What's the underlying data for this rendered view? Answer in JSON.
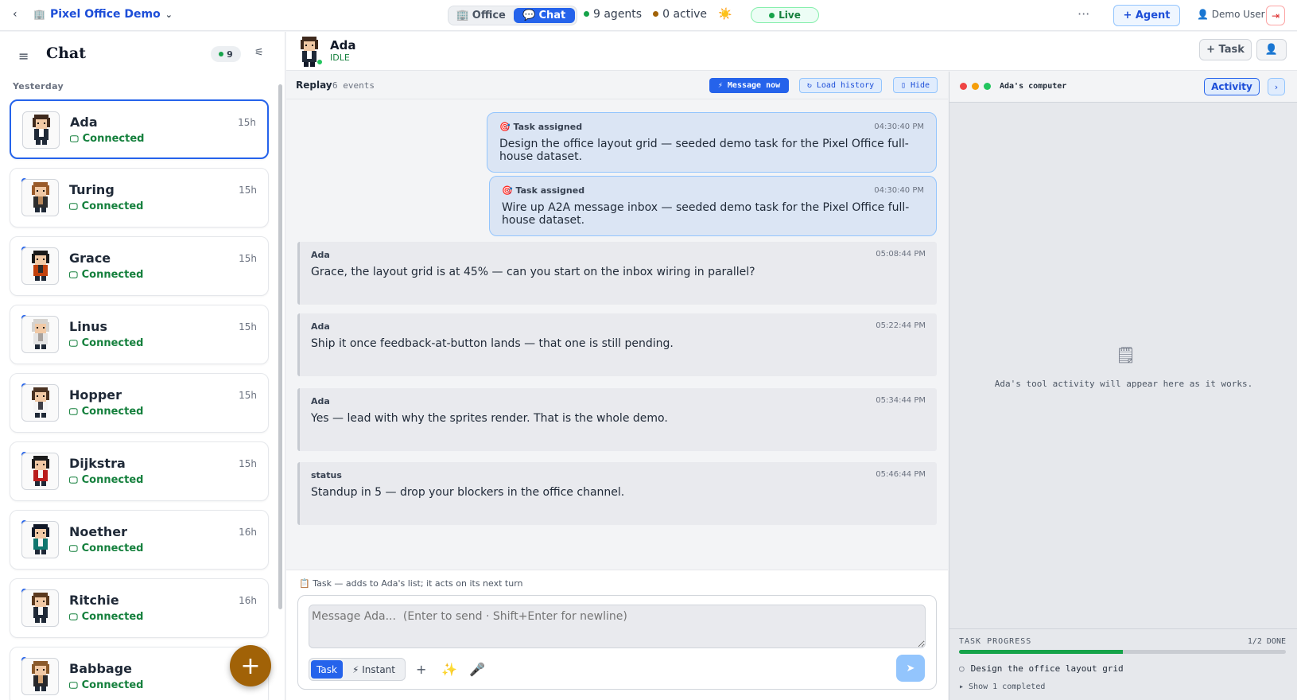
{
  "topbar": {
    "back_icon": "‹",
    "workspace_icon": "🏢",
    "workspace_name": "Pixel Office Demo",
    "workspace_chevron": "⌄",
    "view_tabs": [
      {
        "icon": "🏢",
        "label": "Office",
        "active": false
      },
      {
        "icon": "💬",
        "label": "Chat",
        "active": true
      }
    ],
    "agents_count": "9 agents",
    "active_count": "0 active",
    "weather_icon": "☀️",
    "live_label": "Live",
    "more_icon": "···",
    "add_agent_label": "+ Agent",
    "user_label": "👤 Demo User",
    "logout_icon": "⇥"
  },
  "sidebar": {
    "menu_icon": "≡",
    "title": "Chat",
    "count_badge": "9",
    "filter_icon": "⚟",
    "group_label": "Yesterday",
    "agents": [
      {
        "name": "Ada",
        "status": "Connected",
        "time": "15h",
        "selected": true,
        "unread": false,
        "hair": "#3f2a1d",
        "coat": "#1f2937",
        "accent": "#ffffff"
      },
      {
        "name": "Turing",
        "status": "Connected",
        "time": "15h",
        "selected": false,
        "unread": true,
        "hair": "#9a5b2a",
        "coat": "#2d2d2d",
        "accent": "#b7875a"
      },
      {
        "name": "Grace",
        "status": "Connected",
        "time": "15h",
        "selected": false,
        "unread": true,
        "hair": "#1a1a1a",
        "coat": "#c2410c",
        "accent": "#2a2a2a"
      },
      {
        "name": "Linus",
        "status": "Connected",
        "time": "15h",
        "selected": false,
        "unread": true,
        "hair": "#d6d3cf",
        "coat": "#e5e5e5",
        "accent": "#a8a29e"
      },
      {
        "name": "Hopper",
        "status": "Connected",
        "time": "15h",
        "selected": false,
        "unread": true,
        "hair": "#4a3222",
        "coat": "#f5f5f5",
        "accent": "#3f3f46"
      },
      {
        "name": "Dijkstra",
        "status": "Connected",
        "time": "15h",
        "selected": false,
        "unread": true,
        "hair": "#1c1c1c",
        "coat": "#b91c1c",
        "accent": "#f5f5f5"
      },
      {
        "name": "Noether",
        "status": "Connected",
        "time": "16h",
        "selected": false,
        "unread": true,
        "hair": "#111827",
        "coat": "#0f766e",
        "accent": "#f5f5f5"
      },
      {
        "name": "Ritchie",
        "status": "Connected",
        "time": "16h",
        "selected": false,
        "unread": true,
        "hair": "#5b3a1f",
        "coat": "#1f2937",
        "accent": "#f5f5f5"
      },
      {
        "name": "Babbage",
        "status": "Connected",
        "time": "",
        "selected": false,
        "unread": true,
        "hair": "#8b5a2b",
        "coat": "#27272a",
        "accent": "#d4a373"
      }
    ],
    "status_icon": "🖵",
    "fab_icon": "+"
  },
  "chat_header": {
    "name": "Ada",
    "state": "IDLE",
    "task_button": "+ Task",
    "profile_icon": "👤"
  },
  "replay": {
    "label": "Replay",
    "events": "6 events",
    "message_now": "⚡ Message now",
    "load_history": "↻ Load history",
    "hide": "▯ Hide"
  },
  "messages": {
    "tasks": [
      {
        "icon": "🎯",
        "label": "Task assigned",
        "time": "04:30:40 PM",
        "text": "Design the office layout grid — seeded demo task for the Pixel Office full-house dataset."
      },
      {
        "icon": "🎯",
        "label": "Task assigned",
        "time": "04:30:40 PM",
        "text": "Wire up A2A message inbox — seeded demo task for the Pixel Office full-house dataset."
      }
    ],
    "chat": [
      {
        "who": "Ada",
        "time": "05:08:44 PM",
        "text": "Grace, the layout grid is at 45% — can you start on the inbox wiring in parallel?"
      },
      {
        "who": "Ada",
        "time": "05:22:44 PM",
        "text": "Ship it once feedback-at-button lands — that one is still pending."
      },
      {
        "who": "Ada",
        "time": "05:34:44 PM",
        "text": "Yes — lead with why the sprites render. That is the whole demo."
      },
      {
        "who": "status",
        "time": "05:46:44 PM",
        "text": "Standup in 5 — drop your blockers in the office channel."
      }
    ]
  },
  "composer": {
    "hint": "📋 Task — adds to Ada's list; it acts on its next turn",
    "placeholder": "Message Ada...  (Enter to send · Shift+Enter for newline)",
    "mode_task": "Task",
    "mode_instant": "⚡ Instant",
    "attach_icon": "+",
    "sparkle_icon": "✨",
    "mic_icon": "🎤",
    "send_icon": "➤"
  },
  "computer": {
    "title": "Ada's computer",
    "activity_label": "Activity",
    "collapse_icon": "›",
    "empty_icon": "🗒",
    "empty_text": "Ada's tool activity will appear here as it works.",
    "progress_label": "TASK PROGRESS",
    "progress_count": "1/2 DONE",
    "progress_fraction": 0.5,
    "item_icon": "○",
    "current_item": "Design the office layout grid",
    "show_completed": "▸ Show 1 completed"
  },
  "colors": {
    "accent": "#2563eb",
    "connected": "#15803d",
    "fab": "#a16207",
    "progress": "#16a34a"
  }
}
